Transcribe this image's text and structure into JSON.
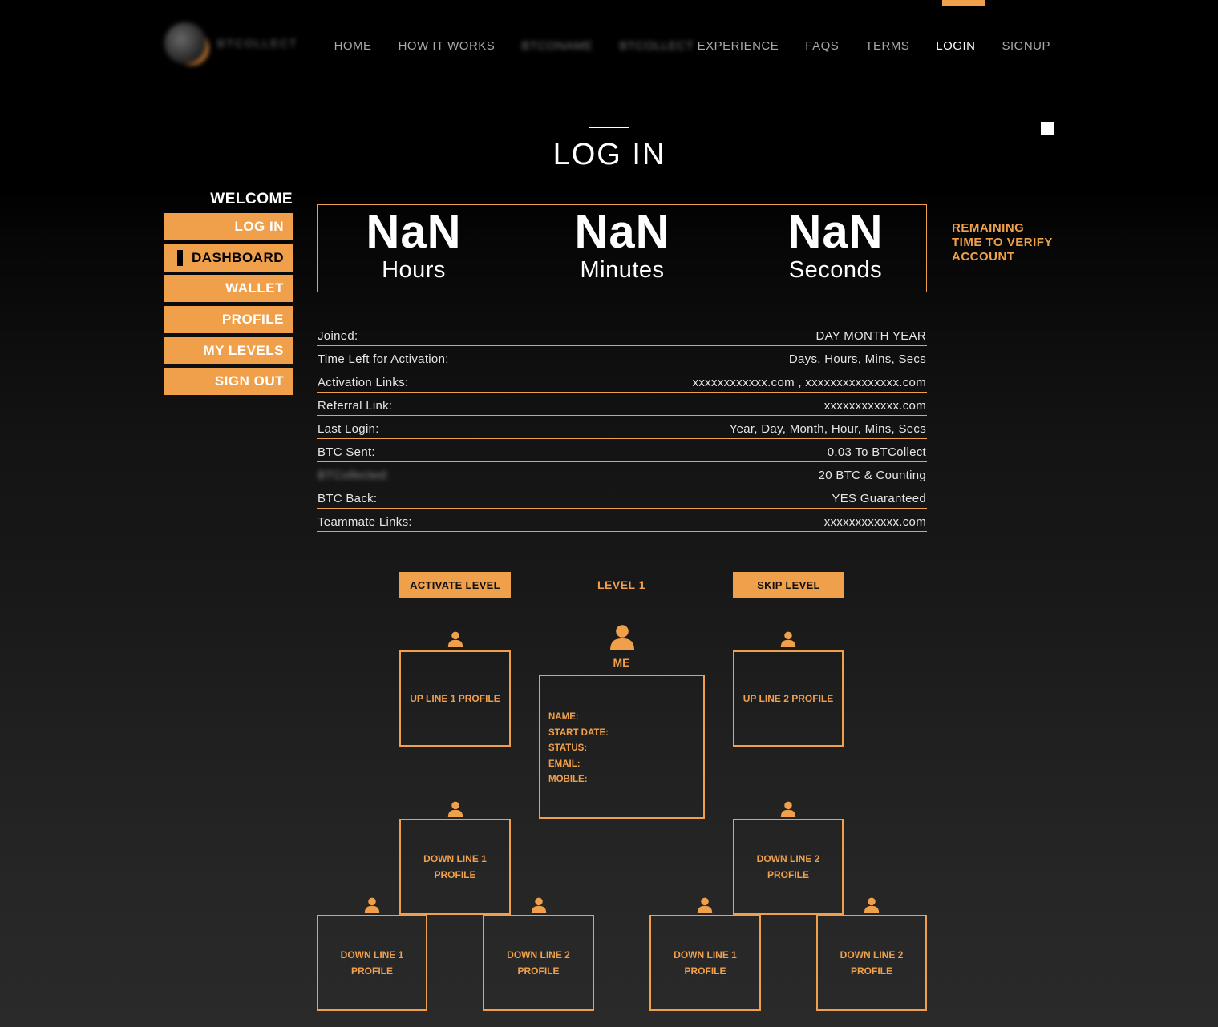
{
  "brand": {
    "logo_text": "BTCOLLECT"
  },
  "nav": {
    "items": [
      {
        "label": "HOME"
      },
      {
        "label": "HOW IT WORKS"
      },
      {
        "label": "BTCONAME"
      },
      {
        "label_blur": "BTCOLLECT",
        "label": "EXPERIENCE"
      },
      {
        "label": "FAQS"
      },
      {
        "label": "TERMS"
      },
      {
        "label": "LOGIN"
      },
      {
        "label": "SIGNUP"
      }
    ]
  },
  "page": {
    "title": "LOG IN"
  },
  "sidebar": {
    "welcome": "WELCOME",
    "items": [
      {
        "label": "LOG IN"
      },
      {
        "label": "DASHBOARD"
      },
      {
        "label": "WALLET"
      },
      {
        "label": "PROFILE"
      },
      {
        "label": "MY LEVELS"
      },
      {
        "label": "SIGN OUT"
      }
    ]
  },
  "countdown": {
    "hours": {
      "value": "NaN",
      "label": "Hours"
    },
    "minutes": {
      "value": "NaN",
      "label": "Minutes"
    },
    "seconds": {
      "value": "NaN",
      "label": "Seconds"
    },
    "side_note": "REMAINING TIME TO VERIFY ACCOUNT"
  },
  "info_rows": [
    {
      "key": "Joined:",
      "value": "DAY MONTH YEAR"
    },
    {
      "key": "Time Left for Activation:",
      "value": "Days, Hours, Mins, Secs"
    },
    {
      "key": "Activation Links:",
      "value": "xxxxxxxxxxxx.com , xxxxxxxxxxxxxxx.com"
    },
    {
      "key": "Referral Link:",
      "value": "xxxxxxxxxxxx.com"
    },
    {
      "key": "Last Login:",
      "value": "Year, Day, Month, Hour, Mins, Secs"
    },
    {
      "key": "BTC Sent:",
      "value": "0.03 To BTCollect"
    },
    {
      "key": "BTCollected:",
      "value": "20 BTC & Counting"
    },
    {
      "key": "BTC Back:",
      "value": "YES Guaranteed"
    },
    {
      "key": "Teammate Links:",
      "value": "xxxxxxxxxxxx.com"
    }
  ],
  "level": {
    "activate_label": "ACTIVATE LEVEL",
    "title": "LEVEL 1",
    "skip_label": "SKIP LEVEL"
  },
  "tree": {
    "me_label": "ME",
    "me_fields": [
      "NAME:",
      "START DATE:",
      "STATUS:",
      "EMAIL:",
      "MOBILE:"
    ],
    "up_line_1": "UP LINE 1 PROFILE",
    "up_line_2": "UP LINE 2 PROFILE",
    "down_line_1": "DOWN LINE 1 PROFILE",
    "down_line_2": "DOWN LINE 2 PROFILE"
  },
  "colors": {
    "accent": "#f0a04b",
    "background": "#000000",
    "text": "#ffffff"
  }
}
